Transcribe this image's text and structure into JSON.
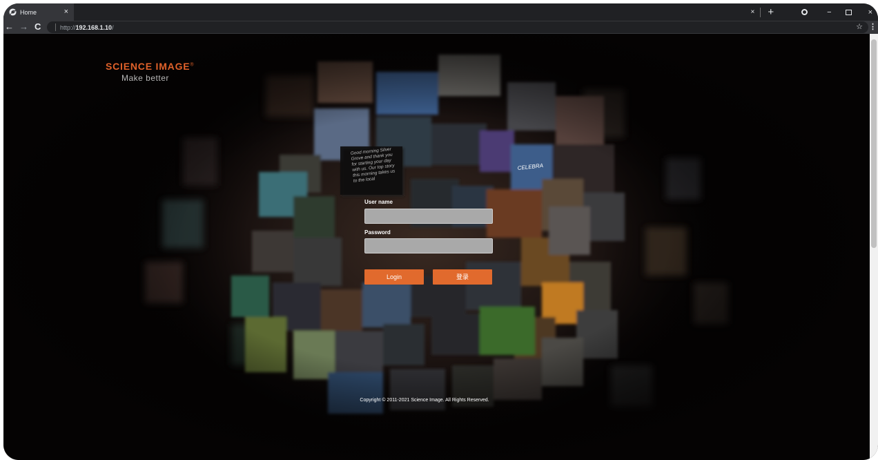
{
  "browser": {
    "tab_title": "Home",
    "tab_close": "×",
    "strip_close": "×",
    "new_tab": "+",
    "url_scheme": "http://",
    "url_host": "192.168.1.10",
    "url_path": "/"
  },
  "brand": {
    "name": "SCIENCE IMAGE",
    "registered": "®",
    "tagline": "Make better",
    "accent_color": "#e0612a"
  },
  "login": {
    "username_label": "User name",
    "username_value": "",
    "password_label": "Password",
    "password_value": "",
    "login_button": "Login",
    "login_button_cn": "登录",
    "button_color": "#e16a2d"
  },
  "footer": {
    "copyright": "Copyright © 2011-2021 Science Image. All Rights Reserved."
  },
  "background": {
    "overlay_text": "Good morning Silver Grove and thank you for starting your day with us. Our top story this morning takes us to the local",
    "screen_caption": "CELEBRA"
  },
  "icons": [
    "chrome-favicon",
    "tab-close-icon",
    "back-arrow-icon",
    "forward-arrow-icon",
    "reload-icon",
    "bookmark-star-icon",
    "menu-dots-icon",
    "extension-icon",
    "minimize-icon",
    "restore-icon",
    "window-close-icon"
  ]
}
